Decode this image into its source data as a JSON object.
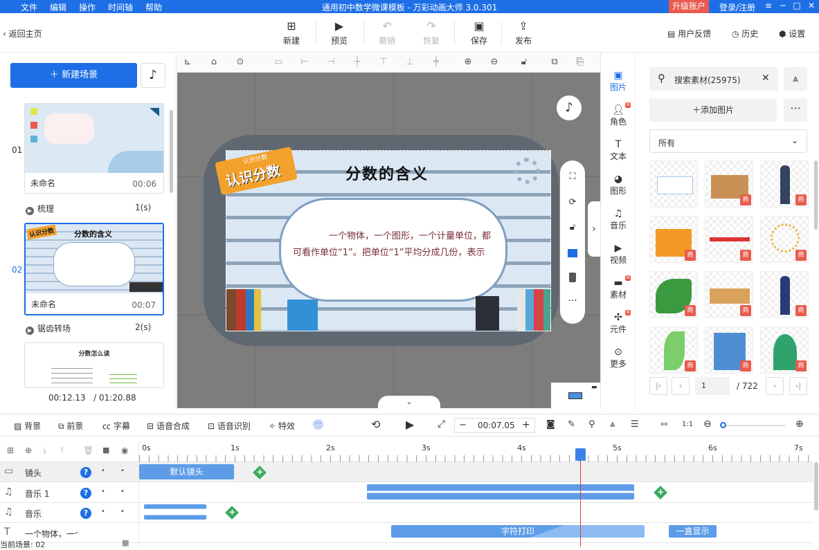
{
  "titlebar": {
    "menu": [
      "文件",
      "编辑",
      "操作",
      "时间轴",
      "帮助"
    ],
    "title": "通用初中数学微课模板 - 万彩动画大师 3.0.301",
    "upgrade": "升级账户",
    "login": "登录/注册",
    "window_buttons": [
      "≡",
      "─",
      "□",
      "✕"
    ]
  },
  "toolbar": {
    "back": "返回主页",
    "buttons": [
      {
        "label": "新建",
        "icon": "plus-square-icon",
        "enabled": true
      },
      {
        "label": "预览",
        "icon": "play-icon",
        "enabled": true
      },
      {
        "label": "撤销",
        "icon": "undo-icon",
        "enabled": false
      },
      {
        "label": "恢复",
        "icon": "redo-icon",
        "enabled": false
      },
      {
        "label": "保存",
        "icon": "save-icon",
        "enabled": true
      },
      {
        "label": "发布",
        "icon": "publish-icon",
        "enabled": true
      }
    ],
    "right": [
      "用户反馈",
      "历史",
      "设置"
    ]
  },
  "left": {
    "new_scene": "新建场景",
    "scenes": [
      {
        "num": "01",
        "name": "未命名",
        "time": "00:06"
      },
      {
        "num": "02",
        "name": "未命名",
        "time": "00:07"
      },
      {
        "num": "",
        "name": "",
        "time": ""
      }
    ],
    "transitions": [
      {
        "name": "梳理",
        "dur": "1(s)"
      },
      {
        "name": "锯齿转场",
        "dur": "2(s)"
      }
    ],
    "scene2_title": "分数的含义",
    "scene3_title": "分数怎么读",
    "current_time": "00:12.13",
    "total_time": "/ 01:20.88"
  },
  "canvas": {
    "tag_small": "认识分数",
    "tag_big": "认识分数",
    "title": "分数的含义",
    "body": "一个物体，一个图形，一个计量单位，都可看作单位“1”。把单位“1”平均分成几份，表示"
  },
  "categories": [
    {
      "label": "图片",
      "icon": "image-icon",
      "active": true,
      "new": false
    },
    {
      "label": "角色",
      "icon": "person-icon",
      "active": false,
      "new": true
    },
    {
      "label": "文本",
      "icon": "text-icon",
      "active": false,
      "new": false
    },
    {
      "label": "图形",
      "icon": "shape-icon",
      "active": false,
      "new": false
    },
    {
      "label": "音乐",
      "icon": "music-icon",
      "active": false,
      "new": false
    },
    {
      "label": "视频",
      "icon": "video-icon",
      "active": false,
      "new": false
    },
    {
      "label": "素材",
      "icon": "folder-icon",
      "active": false,
      "new": true
    },
    {
      "label": "元件",
      "icon": "component-icon",
      "active": false,
      "new": true
    },
    {
      "label": "更多",
      "icon": "more-icon",
      "active": false,
      "new": false
    }
  ],
  "assets": {
    "search": "搜索素材(25975)",
    "add": "添加图片",
    "filter_option": "所有",
    "badge": "商",
    "page": "1",
    "total_pages": "/ 722"
  },
  "timeline": {
    "tools": [
      "背景",
      "前景",
      "字幕",
      "语音合成",
      "语音识别",
      "特效"
    ],
    "current": "00:07.05",
    "ruler": [
      "0s",
      "1s",
      "2s",
      "3s",
      "4s",
      "5s",
      "6s",
      "7s"
    ],
    "tracks": [
      {
        "label": "镜头",
        "icon": "camera-icon"
      },
      {
        "label": "音乐 1",
        "icon": "music-note-icon"
      },
      {
        "label": "音乐",
        "icon": "music-note-icon"
      },
      {
        "label": "一个物体，一个图形",
        "icon": "text-icon"
      }
    ],
    "clips": {
      "camera": "默认镜头",
      "typing": "字符打印",
      "always": "一直显示"
    },
    "footer": "当前场景: 02"
  }
}
